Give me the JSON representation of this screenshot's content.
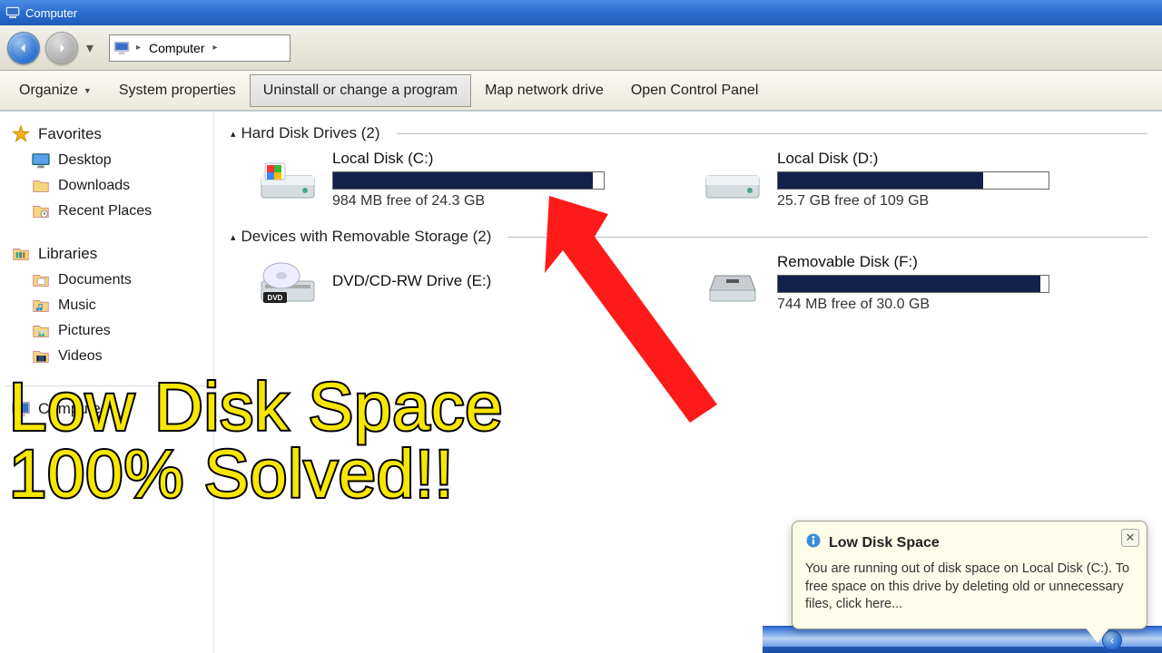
{
  "window": {
    "title": "Computer"
  },
  "breadcrumb": {
    "seg1": "Computer"
  },
  "toolbar": {
    "organize": "Organize",
    "sysprops": "System properties",
    "uninstall": "Uninstall or change a program",
    "mapdrive": "Map network drive",
    "controlpanel": "Open Control Panel"
  },
  "sidebar": {
    "favorites": "Favorites",
    "desktop": "Desktop",
    "downloads": "Downloads",
    "recent": "Recent Places",
    "libraries": "Libraries",
    "documents": "Documents",
    "music": "Music",
    "pictures": "Pictures",
    "videos": "Videos",
    "computer": "Computer"
  },
  "sections": {
    "hdd": "Hard Disk Drives (2)",
    "removable": "Devices with Removable Storage (2)"
  },
  "drives": {
    "c": {
      "name": "Local Disk (C:)",
      "status": "984 MB free of 24.3 GB",
      "fill_pct": 96
    },
    "d": {
      "name": "Local Disk (D:)",
      "status": "25.7 GB free of 109 GB",
      "fill_pct": 76
    },
    "e": {
      "name": "DVD/CD-RW Drive (E:)"
    },
    "f": {
      "name": "Removable Disk (F:)",
      "status": "744 MB free of 30.0 GB",
      "fill_pct": 97
    }
  },
  "overlay": {
    "line1": "Low Disk Space",
    "line2": "100% Solved!!"
  },
  "balloon": {
    "title": "Low Disk Space",
    "body": "You are running out of disk space on Local Disk (C:).  To free space on this drive by deleting old or unnecessary files, click here..."
  }
}
